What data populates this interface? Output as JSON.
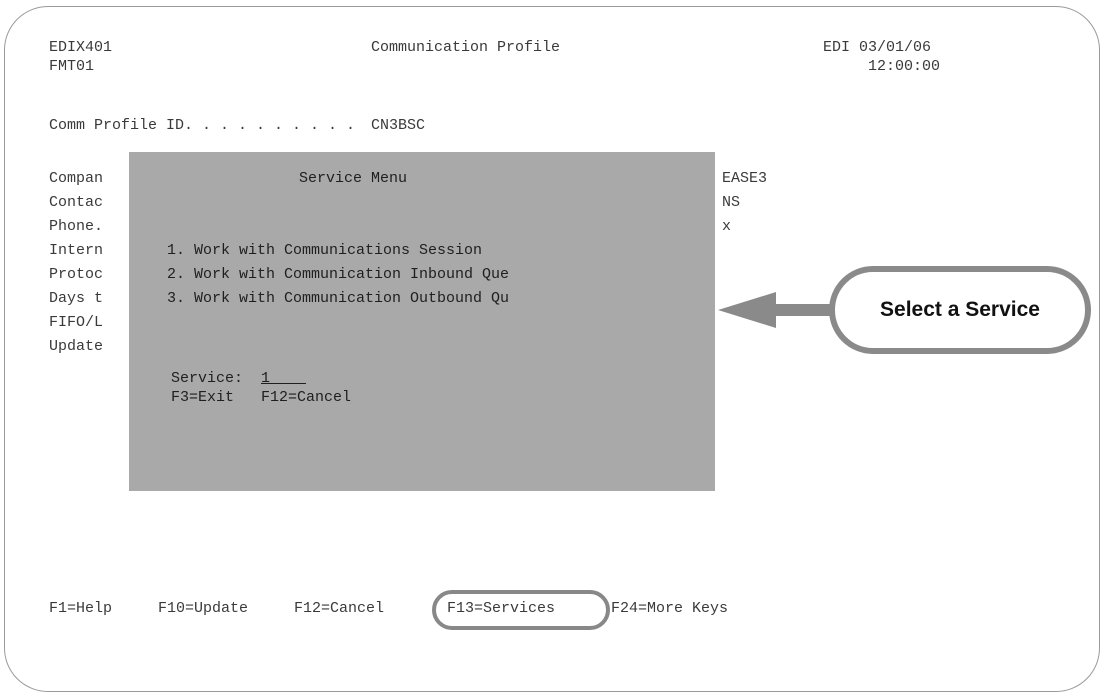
{
  "screen": {
    "program_id": "EDIX401",
    "format_id": "FMT01",
    "title": "Communication Profile",
    "system_date": "EDI 03/01/06",
    "system_time": "12:00:00"
  },
  "profile": {
    "comm_profile_label": "Comm Profile ID. . . . . . . . . .",
    "comm_profile_value": "CN3BSC"
  },
  "background_fields": [
    {
      "label": "Compan",
      "value": "EASE3"
    },
    {
      "label": "Contac",
      "value": "NS"
    },
    {
      "label": "Phone.",
      "value": "x"
    },
    {
      "label": "Intern",
      "value": ""
    },
    {
      "label": "Protoc",
      "value": ""
    },
    {
      "label": "Days t",
      "value": ""
    },
    {
      "label": "FIFO/L",
      "value": ""
    },
    {
      "label": "Update",
      "value": ""
    }
  ],
  "service_menu": {
    "title": "Service Menu",
    "options": [
      "1. Work with Communications Session",
      "2. Work with Communication Inbound Que",
      "3. Work with Communication Outbound Qu"
    ],
    "service_label": "Service:",
    "service_value": "1    ",
    "keys": "F3=Exit   F12=Cancel"
  },
  "function_keys": {
    "f1": "F1=Help",
    "f10": "F10=Update",
    "f12": "F12=Cancel",
    "f13": "F13=Services",
    "f24": "F24=More Keys"
  },
  "callout": {
    "text": "Select a Service",
    "color": "#8a8a8a"
  }
}
